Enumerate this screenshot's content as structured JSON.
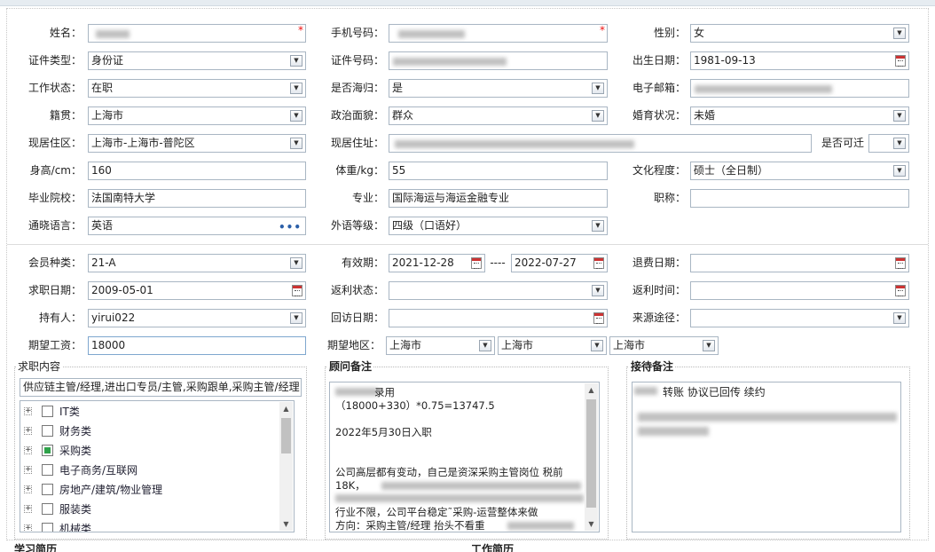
{
  "form": {
    "name": {
      "label": "姓名：",
      "value": ""
    },
    "phone": {
      "label": "手机号码：",
      "value": ""
    },
    "gender": {
      "label": "性别：",
      "value": "女"
    },
    "id_type": {
      "label": "证件类型：",
      "value": "身份证"
    },
    "id_number": {
      "label": "证件号码：",
      "value": ""
    },
    "birth_date": {
      "label": "出生日期：",
      "value": "1981-09-13"
    },
    "work_status": {
      "label": "工作状态：",
      "value": "在职"
    },
    "returnee": {
      "label": "是否海归：",
      "value": "是"
    },
    "email": {
      "label": "电子邮箱：",
      "value": ""
    },
    "native_place": {
      "label": "籍贯：",
      "value": "上海市"
    },
    "political": {
      "label": "政治面貌：",
      "value": "群众"
    },
    "marital": {
      "label": "婚育状况：",
      "value": "未婚"
    },
    "residence_area": {
      "label": "现居住区：",
      "value": "上海市-上海市-普陀区"
    },
    "address": {
      "label": "现居住址：",
      "value": ""
    },
    "relocate": {
      "label": "是否可迁",
      "value": ""
    },
    "height": {
      "label": "身高/cm：",
      "value": "160"
    },
    "weight": {
      "label": "体重/kg：",
      "value": "55"
    },
    "education": {
      "label": "文化程度：",
      "value": "硕士（全日制）"
    },
    "school": {
      "label": "毕业院校：",
      "value": "法国南特大学"
    },
    "major": {
      "label": "专业：",
      "value": "国际海运与海运金融专业"
    },
    "title_rank": {
      "label": "职称：",
      "value": ""
    },
    "language": {
      "label": "通晓语言：",
      "value": "英语"
    },
    "language_level": {
      "label": "外语等级：",
      "value": "四级（口语好）"
    },
    "member_type": {
      "label": "会员种类：",
      "value": "21-A"
    },
    "valid_period": {
      "label": "有效期：",
      "from": "2021-12-28",
      "sep": "----",
      "to": "2022-07-27"
    },
    "refund_date": {
      "label": "退费日期：",
      "value": ""
    },
    "job_date": {
      "label": "求职日期：",
      "value": "2009-05-01"
    },
    "rebate_status": {
      "label": "返利状态：",
      "value": ""
    },
    "rebate_time": {
      "label": "返利时间：",
      "value": ""
    },
    "holder": {
      "label": "持有人：",
      "value": "yirui022"
    },
    "visit_date": {
      "label": "回访日期：",
      "value": ""
    },
    "source": {
      "label": "来源途径：",
      "value": ""
    },
    "salary": {
      "label": "期望工资：",
      "value": "18000"
    },
    "region": {
      "label": "期望地区：",
      "province": "上海市",
      "city": "上海市",
      "district": "上海市"
    }
  },
  "job_content": {
    "title": "求职内容",
    "summary": "供应链主管/经理,进出口专员/主管,采购跟单,采购主管/经理",
    "tree": [
      {
        "label": "IT类",
        "checked": false
      },
      {
        "label": "财务类",
        "checked": false
      },
      {
        "label": "采购类",
        "checked": true
      },
      {
        "label": "电子商务/互联网",
        "checked": false
      },
      {
        "label": "房地产/建筑/物业管理",
        "checked": false
      },
      {
        "label": "服装类",
        "checked": false
      },
      {
        "label": "机械类",
        "checked": false
      }
    ]
  },
  "advisor_notes": {
    "title": "顾问备注",
    "lines": [
      "录用",
      "（18000+330）*0.75=13747.5",
      "",
      "2022年5月30日入职",
      "",
      "",
      "公司高层都有变动，自己是资深采购主管岗位 税前",
      "18K，",
      "",
      "行业不限，公司平台稳定˜采购-运营整体来做",
      "方向：采购主管/经理 抬头不看重"
    ]
  },
  "reception_notes": {
    "title": "接待备注",
    "line1": "转账 协议已回传 续约"
  },
  "bottom": {
    "study": "学习简历",
    "work": "工作简历"
  },
  "icons": {
    "dropdown": "dropdown-arrow-icon",
    "calendar": "calendar-icon",
    "more": "ellipsis-icon",
    "expand": "plus-expander-icon"
  },
  "colors": {
    "required": "#e11111",
    "field_border": "#a9b6c3",
    "checked": "#2fa24a"
  }
}
